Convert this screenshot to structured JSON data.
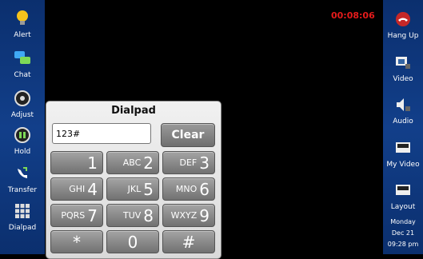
{
  "left_sidebar": [
    {
      "label": "Alert",
      "icon": "lightbulb-icon"
    },
    {
      "label": "Chat",
      "icon": "chat-icon"
    },
    {
      "label": "Adjust",
      "icon": "adjust-icon"
    },
    {
      "label": "Hold",
      "icon": "hold-icon"
    },
    {
      "label": "Transfer",
      "icon": "transfer-icon"
    },
    {
      "label": "Dialpad",
      "icon": "dialpad-icon"
    }
  ],
  "right_sidebar": [
    {
      "label": "Hang Up",
      "icon": "hang-up-icon"
    },
    {
      "label": "Video",
      "icon": "video-icon"
    },
    {
      "label": "Audio",
      "icon": "audio-icon"
    },
    {
      "label": "My Video",
      "icon": "my-video-icon"
    },
    {
      "label": "Layout",
      "icon": "layout-icon"
    }
  ],
  "call_timer": "00:08:06",
  "dialpad": {
    "title": "Dialpad",
    "input_value": "123#",
    "clear_label": "Clear",
    "keys": [
      {
        "letters": "",
        "digit": "1"
      },
      {
        "letters": "ABC",
        "digit": "2"
      },
      {
        "letters": "DEF",
        "digit": "3"
      },
      {
        "letters": "GHI",
        "digit": "4"
      },
      {
        "letters": "JKL",
        "digit": "5"
      },
      {
        "letters": "MNO",
        "digit": "6"
      },
      {
        "letters": "PQRS",
        "digit": "7"
      },
      {
        "letters": "TUV",
        "digit": "8"
      },
      {
        "letters": "WXYZ",
        "digit": "9"
      },
      {
        "letters": "",
        "digit": "*"
      },
      {
        "letters": "",
        "digit": "0"
      },
      {
        "letters": "",
        "digit": "#"
      }
    ]
  },
  "datetime": {
    "day": "Monday",
    "date": "Dec 21",
    "time": "09:28 pm"
  },
  "colors": {
    "sidebar": "#123f8a",
    "timer": "#e41b1b",
    "panel": "#e6e6e6"
  }
}
